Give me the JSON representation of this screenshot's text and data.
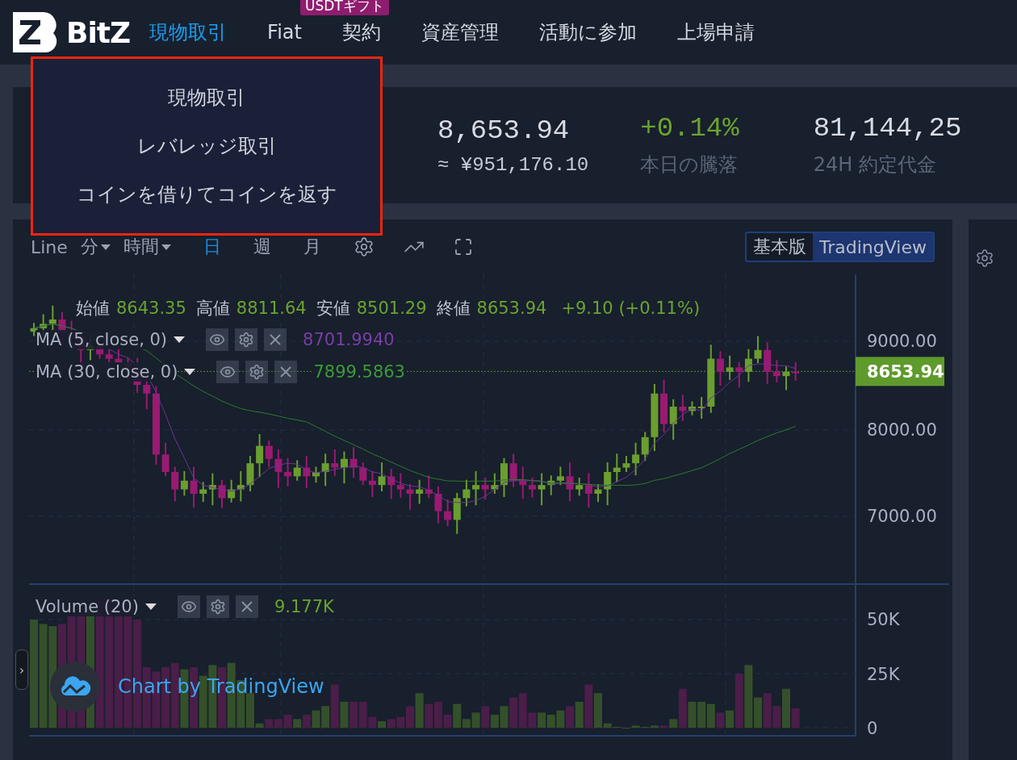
{
  "header": {
    "logo": "BitZ",
    "nav": [
      {
        "label": "現物取引",
        "selected": true
      },
      {
        "label": "Fiat",
        "selected": false
      },
      {
        "label": "契約",
        "selected": false,
        "badge": "USDTギフト"
      },
      {
        "label": "資産管理",
        "selected": false
      },
      {
        "label": "活動に参加",
        "selected": false
      },
      {
        "label": "上場申請",
        "selected": false
      }
    ]
  },
  "dropdown": {
    "items": [
      "現物取引",
      "レバレッジ取引",
      "コインを借りてコインを返す"
    ]
  },
  "ticker": {
    "price": "8,653.94",
    "price_fiat": "≈ ¥951,176.10",
    "stats": [
      {
        "value": "+0.14%",
        "label": "本日の騰落",
        "kind": "change"
      },
      {
        "value": "81,144,25",
        "label": "24H 約定代金",
        "kind": "plain"
      }
    ]
  },
  "chart": {
    "intervals": [
      {
        "label": "Line",
        "selected": false,
        "menu": false
      },
      {
        "label": "分",
        "selected": false,
        "menu": true
      },
      {
        "label": "時間",
        "selected": false,
        "menu": true
      },
      {
        "label": "日",
        "selected": true,
        "menu": false
      },
      {
        "label": "週",
        "selected": false,
        "menu": false
      },
      {
        "label": "月",
        "selected": false,
        "menu": false
      }
    ],
    "versions": [
      {
        "label": "基本版",
        "selected": false
      },
      {
        "label": "TradingView",
        "selected": true
      }
    ],
    "ohlc": [
      {
        "label": "始値",
        "value": "8643.35"
      },
      {
        "label": "高値",
        "value": "8811.64"
      },
      {
        "label": "安値",
        "value": "8501.29"
      },
      {
        "label": "終値",
        "value": "8653.94"
      }
    ],
    "change": "+9.10 (+0.11%)",
    "indicators": [
      {
        "name": "MA (5, close, 0)",
        "value": "8701.9940",
        "color": "#7a3ea6"
      },
      {
        "name": "MA (30, close, 0)",
        "value": "7899.5863",
        "color": "#3d9a35"
      }
    ],
    "price_ticks": [
      "9000.00",
      "8000.00",
      "7000.00"
    ],
    "last_price": "8653.94",
    "volume": {
      "name": "Volume (20)",
      "value": "9.177K",
      "ticks": [
        "50K",
        "25K",
        "0"
      ]
    },
    "attribution": "Chart by TradingView",
    "side_toggle": "›"
  }
}
